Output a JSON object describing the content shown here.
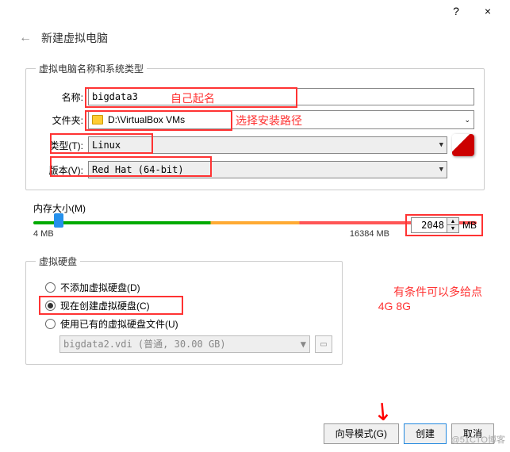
{
  "titlebar": {
    "help_symbol": "?",
    "close_symbol": "×"
  },
  "header": {
    "back_arrow": "←",
    "title": "新建虚拟电脑"
  },
  "group1": {
    "legend": "虚拟电脑名称和系统类型",
    "name_label": "名称:",
    "name_value": "bigdata3",
    "folder_label": "文件夹:",
    "folder_value": "D:\\VirtualBox VMs",
    "type_label": "类型(T):",
    "type_value": "Linux",
    "version_label": "版本(V):",
    "version_value": "Red Hat (64-bit)"
  },
  "annotations": {
    "name_hint": "自己起名",
    "folder_hint": "选择安装路径",
    "mem_hint1": "有条件可以多给点",
    "mem_hint2": "4G 8G"
  },
  "memory": {
    "legend": "内存大小(M)",
    "min": "4 MB",
    "max": "16384 MB",
    "value": "2048",
    "unit": "MB"
  },
  "disk": {
    "legend": "虚拟硬盘",
    "opt_none": "不添加虚拟硬盘(D)",
    "opt_create": "现在创建虚拟硬盘(C)",
    "opt_existing": "使用已有的虚拟硬盘文件(U)",
    "existing_value": "bigdata2.vdi (普通, 30.00 GB)"
  },
  "buttons": {
    "guide": "向导模式(G)",
    "create": "创建",
    "cancel": "取消"
  },
  "watermark": "@51CTO博客"
}
